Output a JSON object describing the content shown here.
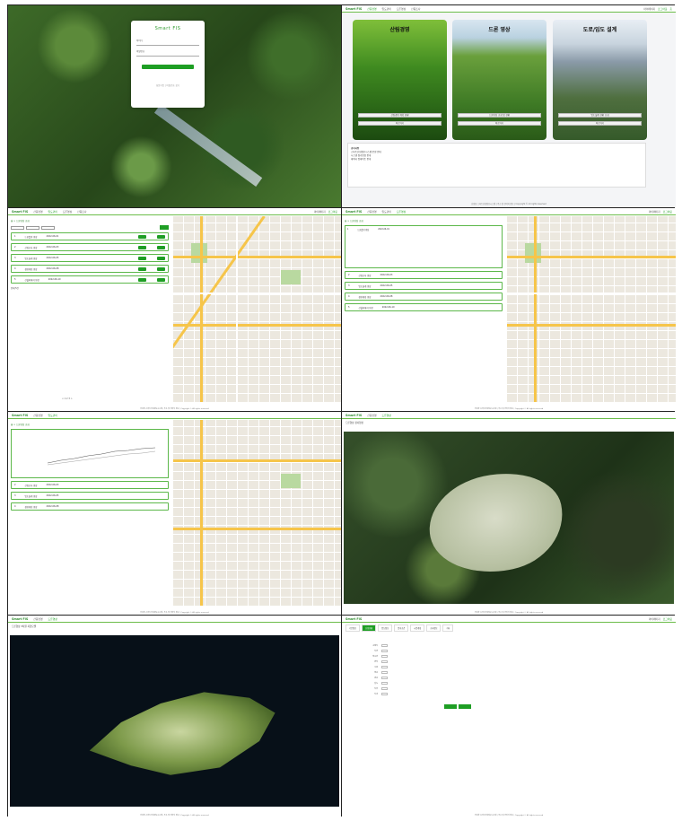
{
  "login": {
    "app_title": "Smart FIS",
    "id_label": "아이디",
    "pw_label": "비밀번호",
    "login_btn": "로그인",
    "footer": "회원가입 | 비밀번호 찾기"
  },
  "header": {
    "logo": "Smart FIS",
    "nav": [
      "산림경영",
      "임도관리",
      "드론영상",
      "산림조사"
    ],
    "right": [
      "마이페이지",
      "로그아웃",
      "홈"
    ]
  },
  "cards": [
    {
      "title": "산림경영",
      "btn1": "산림경영 계획 현황",
      "btn2": "바로가기"
    },
    {
      "title": "드론 영상",
      "btn1": "드론영상 조회 및 현황",
      "btn2": "바로가기"
    },
    {
      "title": "도로/임도 설계",
      "btn1": "임도설계 현황 조회",
      "btn2": "바로가기"
    }
  ],
  "notice": {
    "title": "공지사항",
    "lines": [
      "스마트산림정보시스템 운영 안내",
      "시스템 정기점검 안내",
      "데이터 업데이트 안내"
    ]
  },
  "list": {
    "breadcrumb": "홈 > 드론영상 조회",
    "search_btn": "조회",
    "rows": [
      {
        "no": "1",
        "name": "드론촬영 영상",
        "date": "2022-06-01"
      },
      {
        "no": "2",
        "name": "산림조사 영상",
        "date": "2022-06-03"
      },
      {
        "no": "3",
        "name": "임도설계 영상",
        "date": "2022-06-05"
      },
      {
        "no": "4",
        "name": "경영계획 영상",
        "date": "2022-06-08"
      },
      {
        "no": "5",
        "name": "산불피해지 영상",
        "date": "2022-06-10"
      }
    ],
    "total": "전체 5건"
  },
  "map_title": "드론영상 3차원 지형모델",
  "sat_title": "드론영상 정사영상",
  "form": {
    "tabs": [
      "기본정보",
      "산림현황",
      "임도정보",
      "입지조건",
      "시업계획",
      "조사정보",
      "기타"
    ],
    "fields": [
      "소재지",
      "지번",
      "임소반",
      "면적",
      "수종",
      "영급",
      "경급",
      "밀도",
      "지위",
      "지리"
    ]
  },
  "footer": "산림청 스마트산림정보시스템 | 주소 및 연락처 정보 | Copyright © All rights reserved"
}
